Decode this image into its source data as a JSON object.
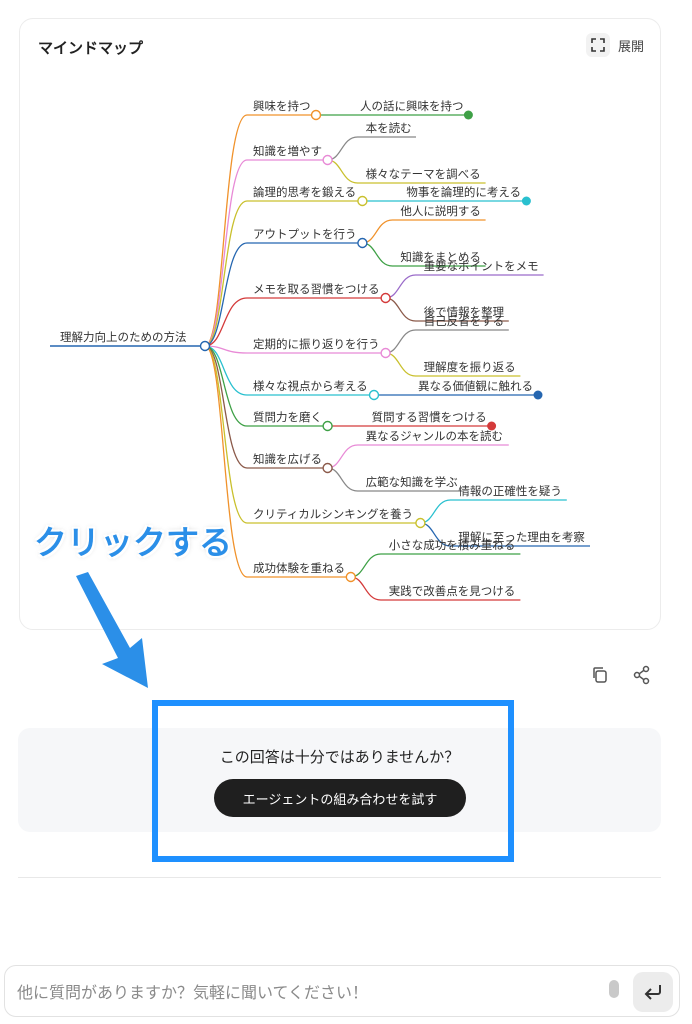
{
  "card": {
    "title": "マインドマップ",
    "expand_label": "展開"
  },
  "mindmap": {
    "root": "理解力向上のための方法",
    "branches": [
      {
        "label": "興味を持つ",
        "color": "#f0922b",
        "children": [
          {
            "label": "人の話に興味を持つ",
            "color": "#3ea046"
          }
        ]
      },
      {
        "label": "知識を増やす",
        "color": "#e88ad6",
        "children": [
          {
            "label": "本を読む",
            "color": "#888888"
          },
          {
            "label": "様々なテーマを調べる",
            "color": "#c9c02d"
          }
        ]
      },
      {
        "label": "論理的思考を鍛える",
        "color": "#c9c02d",
        "children": [
          {
            "label": "物事を論理的に考える",
            "color": "#29c0cf"
          }
        ]
      },
      {
        "label": "アウトプットを行う",
        "color": "#2566b0",
        "children": [
          {
            "label": "他人に説明する",
            "color": "#f0922b"
          },
          {
            "label": "知識をまとめる",
            "color": "#3ea046"
          }
        ]
      },
      {
        "label": "メモを取る習慣をつける",
        "color": "#d43a3a",
        "children": [
          {
            "label": "重要なポイントをメモ",
            "color": "#9a6bc9"
          },
          {
            "label": "後で情報を整理",
            "color": "#8b5a4a"
          }
        ]
      },
      {
        "label": "定期的に振り返りを行う",
        "color": "#e88ad6",
        "children": [
          {
            "label": "自己反省をする",
            "color": "#888888"
          },
          {
            "label": "理解度を振り返る",
            "color": "#c9c02d"
          }
        ]
      },
      {
        "label": "様々な視点から考える",
        "color": "#29c0cf",
        "children": [
          {
            "label": "異なる価値観に触れる",
            "color": "#2566b0"
          }
        ]
      },
      {
        "label": "質問力を磨く",
        "color": "#3ea046",
        "children": [
          {
            "label": "質問する習慣をつける",
            "color": "#d43a3a"
          }
        ]
      },
      {
        "label": "知識を広げる",
        "color": "#8b5a4a",
        "children": [
          {
            "label": "異なるジャンルの本を読む",
            "color": "#e88ad6"
          },
          {
            "label": "広範な知識を学ぶ",
            "color": "#888888"
          }
        ]
      },
      {
        "label": "クリティカルシンキングを養う",
        "color": "#c9c02d",
        "children": [
          {
            "label": "情報の正確性を疑う",
            "color": "#29c0cf"
          },
          {
            "label": "理解に至った理由を考察",
            "color": "#2566b0"
          }
        ]
      },
      {
        "label": "成功体験を重ねる",
        "color": "#f0922b",
        "children": [
          {
            "label": "小さな成功を積み重ねる",
            "color": "#3ea046"
          },
          {
            "label": "実践で改善点を見つける",
            "color": "#d43a3a"
          }
        ]
      }
    ]
  },
  "annotation": {
    "text": "クリックする",
    "color": "#2b8fe8"
  },
  "feedback": {
    "question": "この回答は十分ではありませんか？",
    "button_label": "エージェントの組み合わせを試す"
  },
  "input": {
    "placeholder": "他に質問がありますか？気軽に聞いてください！"
  },
  "icons": {
    "expand": "expand-icon",
    "copy": "copy-icon",
    "share": "share-icon",
    "mic": "mic-icon",
    "send": "enter-icon"
  }
}
